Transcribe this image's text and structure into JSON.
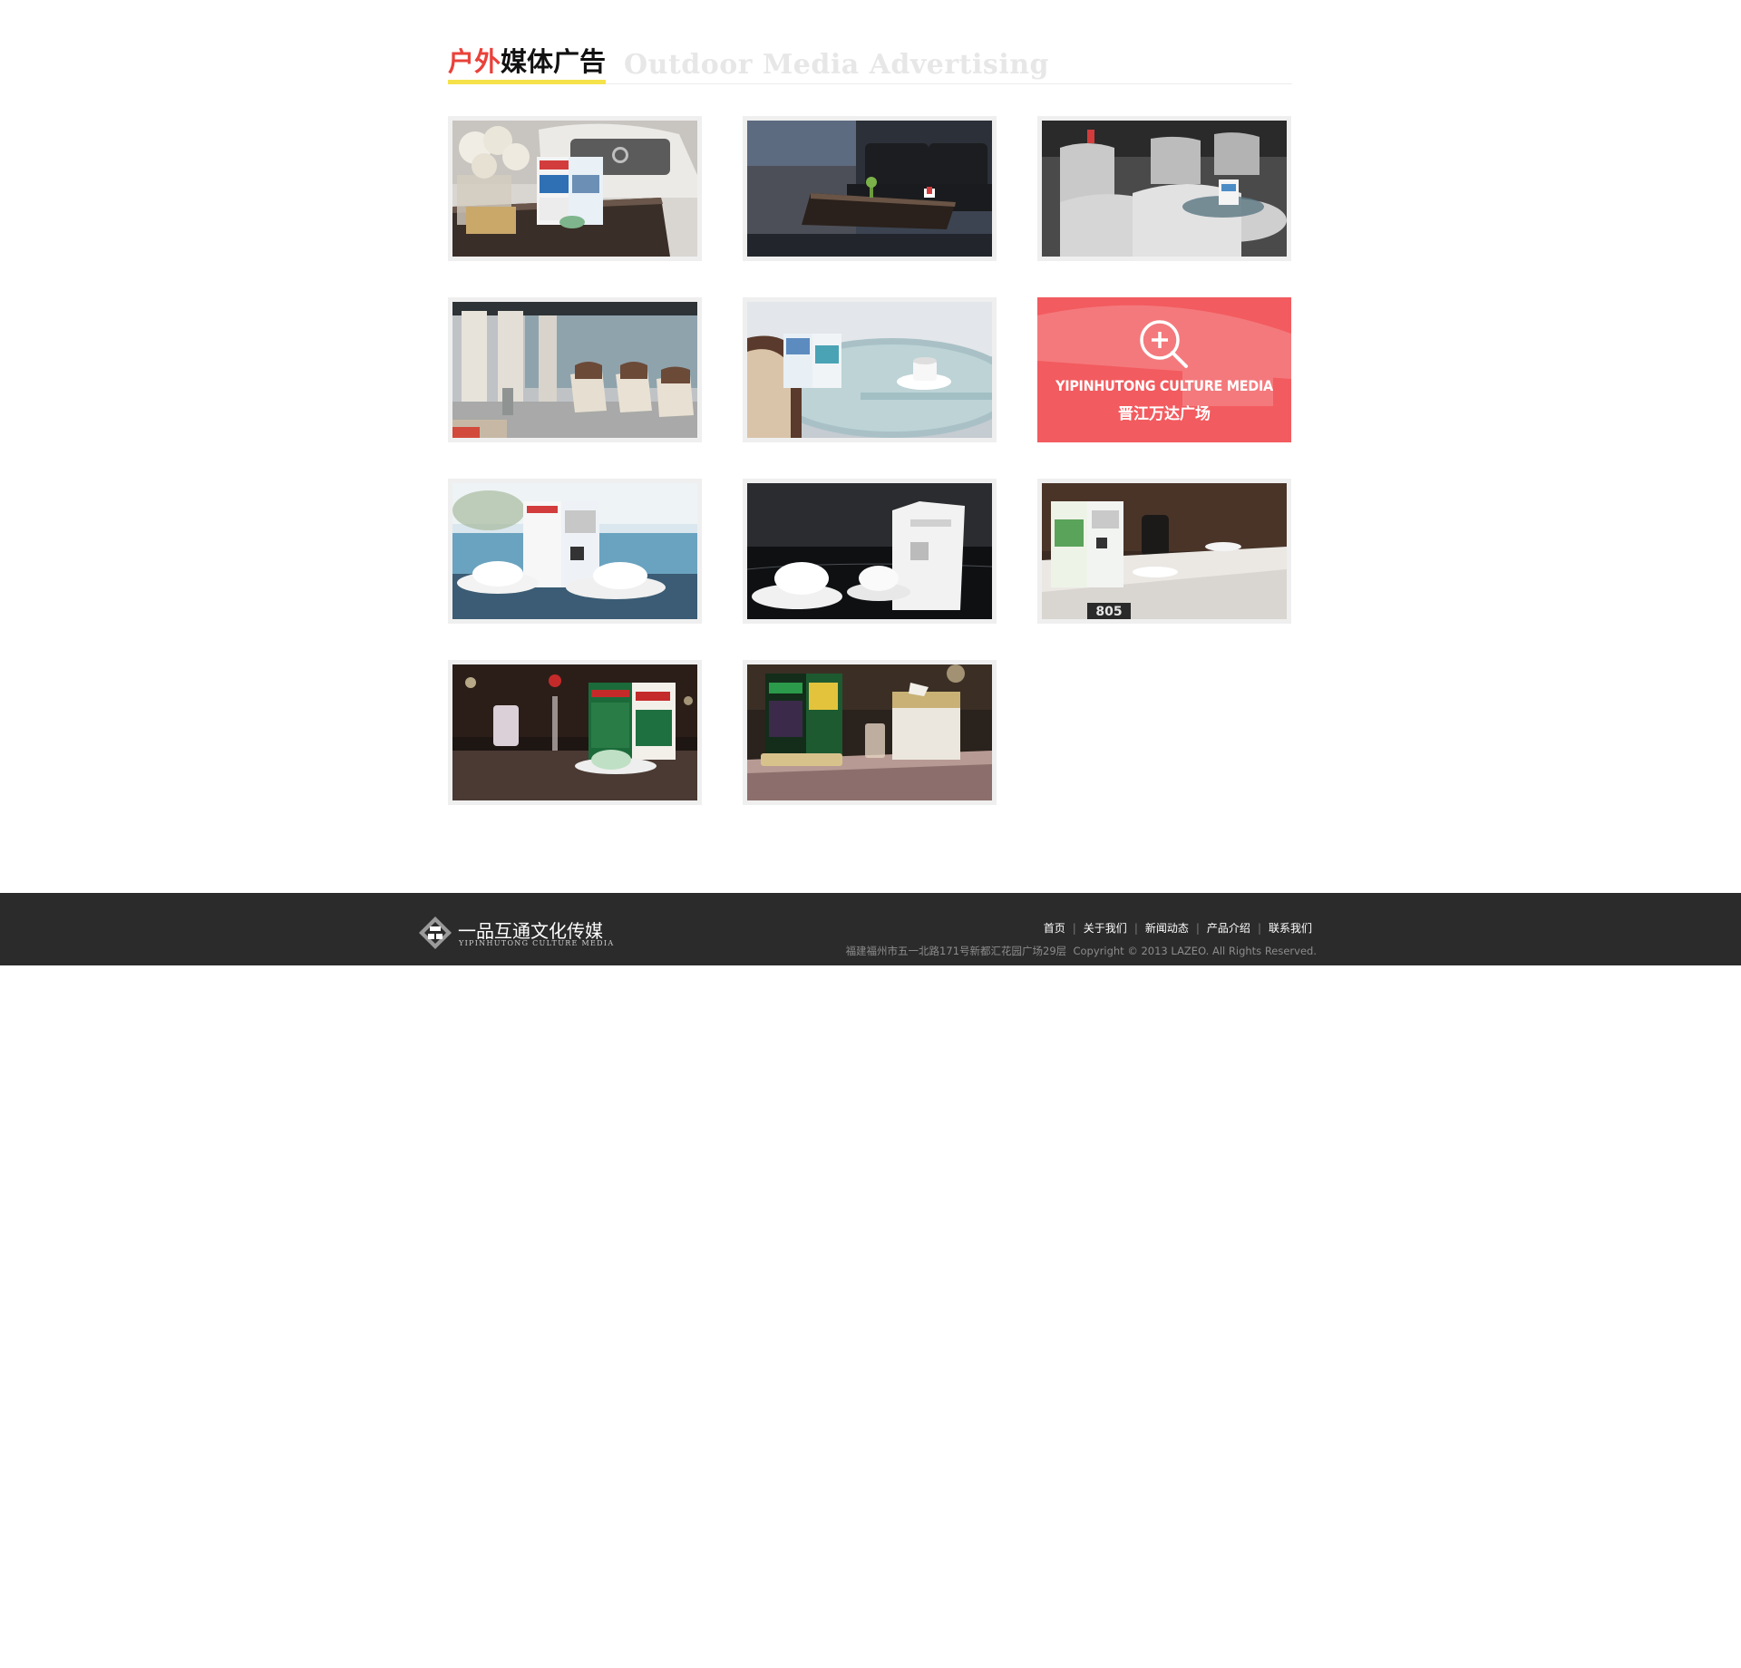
{
  "section": {
    "title_red": "户外",
    "title_black": "媒体广告",
    "title_en": "Outdoor Media Advertising"
  },
  "gallery": {
    "items": [
      {
        "scene": "car showroom table with flowers and ad display"
      },
      {
        "scene": "lounge with black leather sofas"
      },
      {
        "scene": "white rattan chairs around glass table"
      },
      {
        "scene": "lobby colonnade with armchairs"
      },
      {
        "scene": "glass table with coffee cup and ad stand"
      },
      {
        "scene": "highlighted item (hover state)"
      },
      {
        "scene": "waterside table with bowls"
      },
      {
        "scene": "dark marble table with bowls"
      },
      {
        "scene": "restaurant table number 805"
      },
      {
        "scene": "night table with vase and menu stand"
      },
      {
        "scene": "bar counter with tissue box and ad stand"
      }
    ],
    "overlay": {
      "title_en": "YIPINHUTONG CULTURE MEDIA",
      "title_cn": "晋江万达广场",
      "icon": "zoom-in-icon"
    },
    "photo_text": {
      "table_number": "805"
    }
  },
  "footer": {
    "logo_cn": "一品互通文化传媒",
    "logo_en": "YIPINHUTONG CULTURE MEDIA",
    "nav": [
      "首页",
      "关于我们",
      "新闻动态",
      "产品介绍",
      "联系我们"
    ],
    "address": "福建福州市五一北路171号新都汇花园广场29层",
    "copyright": "Copyright © 2013 LAZEO. All Rights Reserved."
  },
  "colors": {
    "accent_red": "#e9423b",
    "accent_yellow": "#f5e24a",
    "overlay_bg": "#f25b5f",
    "footer_bg": "#2b2b2b"
  }
}
